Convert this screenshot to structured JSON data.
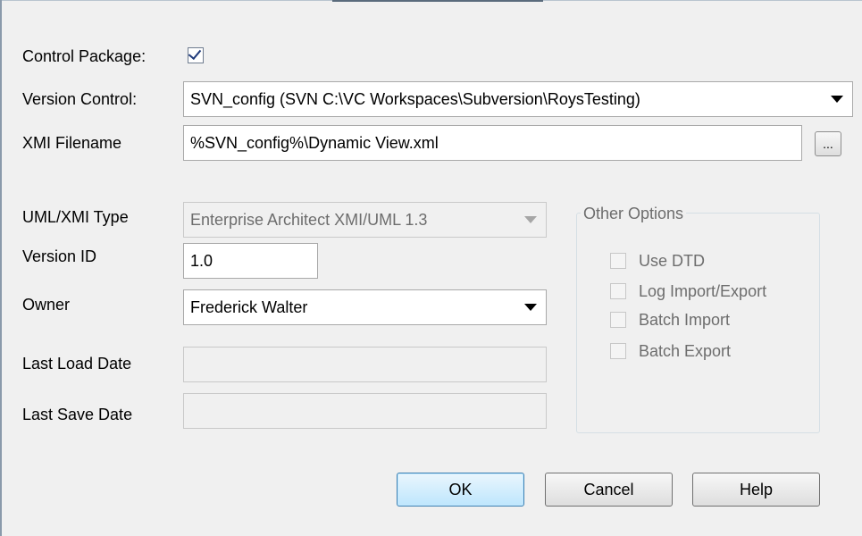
{
  "form": {
    "control_package_label": "Control Package:",
    "control_package_checked": true,
    "version_control_label": "Version Control:",
    "version_control_value": "SVN_config (SVN C:\\VC Workspaces\\Subversion\\RoysTesting)",
    "xmi_filename_label": "XMI Filename",
    "xmi_filename_value": "%SVN_config%\\Dynamic View.xml",
    "browse_label": "...",
    "uml_xmi_type_label": "UML/XMI Type",
    "uml_xmi_type_value": "Enterprise Architect XMI/UML 1.3",
    "version_id_label": "Version ID",
    "version_id_value": "1.0",
    "owner_label": "Owner",
    "owner_value": "Frederick Walter",
    "last_load_date_label": "Last Load Date",
    "last_load_date_value": "",
    "last_save_date_label": "Last Save Date",
    "last_save_date_value": ""
  },
  "other_options": {
    "title": "Other Options",
    "use_dtd": "Use DTD",
    "log_import_export": "Log Import/Export",
    "batch_import": "Batch Import",
    "batch_export": "Batch Export"
  },
  "buttons": {
    "ok": "OK",
    "cancel": "Cancel",
    "help": "Help"
  },
  "colors": {
    "dialog_bg": "#f0f0f0",
    "disabled_text": "#6d6d6d",
    "default_button_border": "#3c7fb1"
  }
}
